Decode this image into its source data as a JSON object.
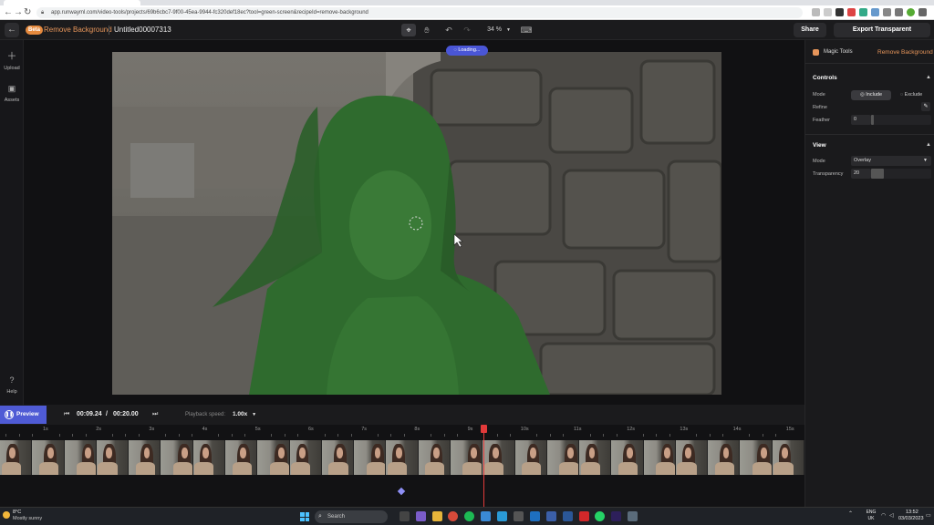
{
  "browser": {
    "url": "app.runwayml.com/video-tools/projects/69b6cbc7-9f00-45ea-9944-fc320def18ec?tool=green-screen&recipeId=remove-background"
  },
  "header": {
    "badge": "Beta",
    "app_title": "Remove Background",
    "project_title": "Untitled00007313",
    "zoom": "34 %",
    "share_label": "Share",
    "export_label": "Export Transparent Background"
  },
  "sidebar": {
    "items": [
      {
        "label": "Upload",
        "icon": "plus-icon"
      },
      {
        "label": "Assets",
        "icon": "folder-icon"
      },
      {
        "label": "Help",
        "icon": "help-icon"
      }
    ]
  },
  "canvas": {
    "loading_label": "Loading..."
  },
  "panel": {
    "magic_tools": "Magic Tools",
    "tool_name": "Remove Background",
    "controls": {
      "title": "Controls",
      "mode_label": "Mode",
      "include": "Include",
      "exclude": "Exclude",
      "refine_label": "Refine",
      "feather_label": "Feather",
      "feather_value": "0"
    },
    "view": {
      "title": "View",
      "mode_label": "Mode",
      "mode_value": "Overlay",
      "transparency_label": "Transparency",
      "transparency_value": "20"
    }
  },
  "transport": {
    "preview_label": "Preview",
    "time_current": "00:09.24",
    "time_sep": "/",
    "time_total": "00:20.00",
    "speed_label": "Playback speed:",
    "speed_value": "1.00x"
  },
  "timeline": {
    "ticks": [
      "1s",
      "2s",
      "3s",
      "4s",
      "5s",
      "6s",
      "7s",
      "8s",
      "9s",
      "10s",
      "11s",
      "12s",
      "13s",
      "14s",
      "15s"
    ],
    "playhead_time_s": 9.24
  },
  "taskbar": {
    "temperature": "8°C",
    "weather": "Mostly sunny",
    "search_placeholder": "Search",
    "lang_top": "ENG",
    "lang_bottom": "UK",
    "time": "13:52",
    "date": "03/03/2023"
  },
  "colors": {
    "accent_orange": "#e6955a",
    "accent_blue": "#4f5bd5",
    "playhead": "#e23a3a",
    "mask_green": "#2f7a32"
  }
}
